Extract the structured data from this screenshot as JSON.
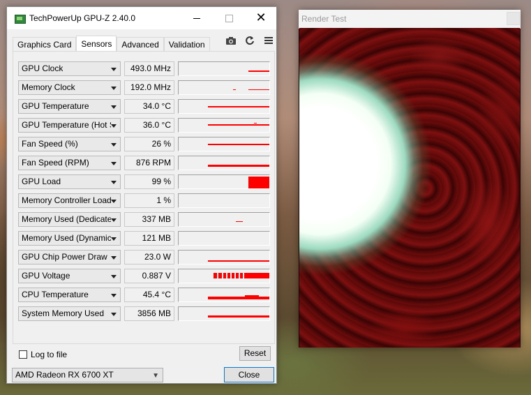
{
  "window": {
    "title": "TechPowerUp GPU-Z 2.40.0",
    "icon": "gpuz-app-icon",
    "controls": [
      "minimize-icon",
      "maximize-icon",
      "close-icon"
    ]
  },
  "tabs": [
    {
      "label": "Graphics Card",
      "active": false
    },
    {
      "label": "Sensors",
      "active": true
    },
    {
      "label": "Advanced",
      "active": false
    },
    {
      "label": "Validation",
      "active": false
    }
  ],
  "toolbar": {
    "icons": [
      "camera-icon",
      "refresh-icon",
      "menu-icon"
    ]
  },
  "sensors": [
    {
      "label": "GPU Clock",
      "value": "493.0 MHz"
    },
    {
      "label": "Memory Clock",
      "value": "192.0 MHz"
    },
    {
      "label": "GPU Temperature",
      "value": "34.0 °C"
    },
    {
      "label": "GPU Temperature (Hot Spot)",
      "value": "36.0 °C"
    },
    {
      "label": "Fan Speed (%)",
      "value": "26 %"
    },
    {
      "label": "Fan Speed (RPM)",
      "value": "876 RPM"
    },
    {
      "label": "GPU Load",
      "value": "99 %"
    },
    {
      "label": "Memory Controller Load",
      "value": "1 %"
    },
    {
      "label": "Memory Used (Dedicated)",
      "value": "337 MB"
    },
    {
      "label": "Memory Used (Dynamic)",
      "value": "121 MB"
    },
    {
      "label": "GPU Chip Power Draw",
      "value": "23.0 W"
    },
    {
      "label": "GPU Voltage",
      "value": "0.887 V"
    },
    {
      "label": "CPU Temperature",
      "value": "45.4 °C"
    },
    {
      "label": "System Memory Used",
      "value": "3856 MB"
    }
  ],
  "footer": {
    "log_label": "Log to file",
    "log_checked": false,
    "reset_label": "Reset",
    "gpu_selected": "AMD Radeon RX 6700 XT",
    "close_label": "Close"
  },
  "render_window": {
    "title": "Render Test"
  },
  "colors": {
    "graph_line": "#ff0000",
    "accent_border": "#0078d7"
  }
}
